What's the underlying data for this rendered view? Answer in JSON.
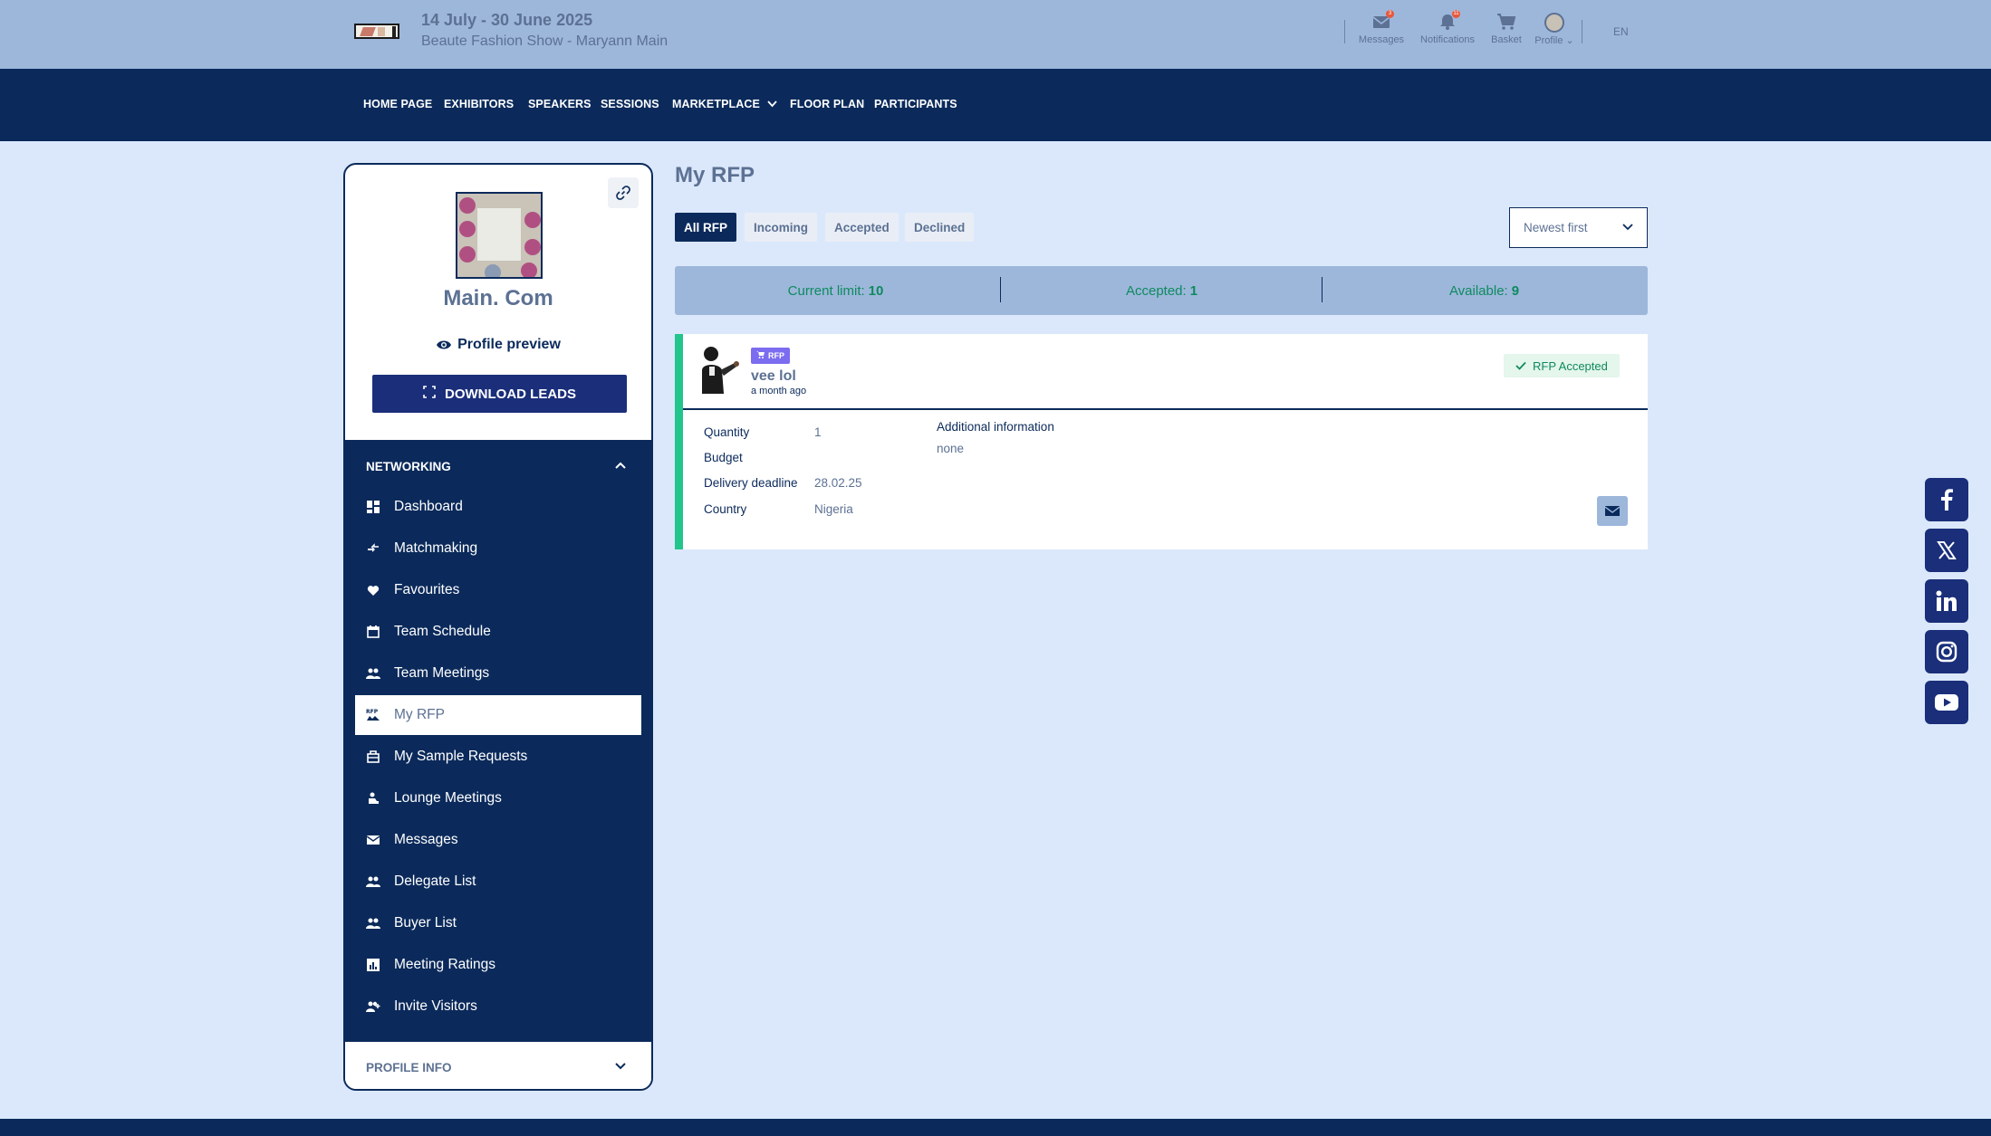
{
  "header": {
    "event_dates": "14 July - 30 June 2025",
    "event_name": "Beaute Fashion Show - Maryann Main",
    "items": {
      "messages": {
        "label": "Messages",
        "icon": "envelope-icon",
        "badge": "3"
      },
      "notifications": {
        "label": "Notifications",
        "icon": "bell-icon",
        "badge": "11"
      },
      "basket": {
        "label": "Basket",
        "icon": "cart-icon"
      },
      "profile": {
        "label": "Profile",
        "icon": "avatar"
      }
    },
    "language": "EN"
  },
  "nav": {
    "items": [
      "HOME PAGE",
      "EXHIBITORS",
      "SPEAKERS",
      "SESSIONS",
      "MARKETPLACE",
      "FLOOR PLAN",
      "PARTICIPANTS"
    ]
  },
  "sidebar": {
    "company_name": "Main. Com",
    "profile_preview": "Profile preview",
    "download_leads": "DOWNLOAD LEADS",
    "networking_title": "NETWORKING",
    "menu": [
      {
        "label": "Dashboard",
        "icon": "dashboard-icon"
      },
      {
        "label": "Matchmaking",
        "icon": "matchmaking-icon"
      },
      {
        "label": "Favourites",
        "icon": "heart-icon"
      },
      {
        "label": "Team Schedule",
        "icon": "calendar-icon"
      },
      {
        "label": "Team Meetings",
        "icon": "team-icon"
      },
      {
        "label": "My RFP",
        "icon": "rfp-icon",
        "active": true
      },
      {
        "label": "My Sample Requests",
        "icon": "sample-icon"
      },
      {
        "label": "Lounge Meetings",
        "icon": "lounge-icon"
      },
      {
        "label": "Messages",
        "icon": "envelope-icon"
      },
      {
        "label": "Delegate List",
        "icon": "people-icon"
      },
      {
        "label": "Buyer List",
        "icon": "people-icon"
      },
      {
        "label": "Meeting Ratings",
        "icon": "chart-icon"
      },
      {
        "label": "Invite Visitors",
        "icon": "invite-icon"
      }
    ],
    "profile_info_title": "PROFILE INFO"
  },
  "main": {
    "title": "My RFP",
    "tabs": [
      "All RFP",
      "Incoming",
      "Accepted",
      "Declined"
    ],
    "active_tab": "All RFP",
    "sort": "Newest first",
    "limits": {
      "current_label": "Current limit:",
      "current_value": "10",
      "accepted_label": "Accepted:",
      "accepted_value": "1",
      "available_label": "Available:",
      "available_value": "9"
    },
    "rfp": {
      "badge": "RFP",
      "name": "vee lol",
      "time": "a month ago",
      "status": "RFP Accepted",
      "fields": {
        "quantity_label": "Quantity",
        "quantity_value": "1",
        "budget_label": "Budget",
        "budget_value": "",
        "deadline_label": "Delivery deadline",
        "deadline_value": "28.02.25",
        "country_label": "Country",
        "country_value": "Nigeria"
      },
      "additional_label": "Additional information",
      "additional_value": "none"
    }
  },
  "social": [
    "facebook-icon",
    "x-icon",
    "linkedin-icon",
    "instagram-icon",
    "youtube-icon"
  ],
  "colors": {
    "navy": "#0b2a5b",
    "accent_green": "#22c58b",
    "status_green": "#0e8a5e",
    "header_bg": "#9db7db",
    "page_bg": "#dbe8fb"
  }
}
